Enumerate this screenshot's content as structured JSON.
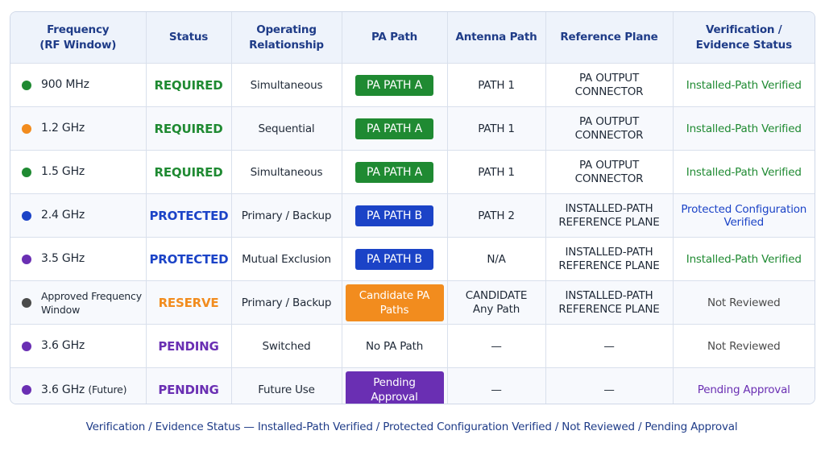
{
  "headers": {
    "frequency": "Frequency\n(RF Window)",
    "status": "Status",
    "operating": "Operating\nRelationship",
    "pa_path": "PA Path",
    "antenna_path": "Antenna Path",
    "reference_plane": "Reference Plane",
    "verification": "Verification /\nEvidence Status"
  },
  "colors": {
    "green": "#1f8a32",
    "orange": "#f28c1e",
    "blue": "#1b43c7",
    "purple": "#6a2fb3",
    "gray": "#4b4b4b",
    "header_text": "#1f3c88"
  },
  "rows": [
    {
      "frequency": "900 MHz",
      "dot": "green",
      "status": "REQUIRED",
      "status_color": "green",
      "operating": "Simultaneous",
      "pa_path": "PA PATH A",
      "pa_style": "pill",
      "pa_color": "green",
      "antenna": "PATH 1",
      "reference": "PA OUTPUT\nCONNECTOR",
      "verification": "Installed-Path Verified",
      "verification_color": "green"
    },
    {
      "frequency": "1.2 GHz",
      "dot": "orange",
      "status": "REQUIRED",
      "status_color": "green",
      "operating": "Sequential",
      "pa_path": "PA PATH A",
      "pa_style": "pill",
      "pa_color": "green",
      "antenna": "PATH 1",
      "reference": "PA OUTPUT\nCONNECTOR",
      "verification": "Installed-Path Verified",
      "verification_color": "green"
    },
    {
      "frequency": "1.5 GHz",
      "dot": "green",
      "status": "REQUIRED",
      "status_color": "green",
      "operating": "Simultaneous",
      "pa_path": "PA PATH A",
      "pa_style": "pill",
      "pa_color": "green",
      "antenna": "PATH 1",
      "reference": "PA OUTPUT\nCONNECTOR",
      "verification": "Installed-Path Verified",
      "verification_color": "green"
    },
    {
      "frequency": "2.4 GHz",
      "dot": "blue",
      "status": "PROTECTED",
      "status_color": "blue",
      "operating": "Primary / Backup",
      "pa_path": "PA PATH B",
      "pa_style": "pill",
      "pa_color": "blue",
      "antenna": "PATH 2",
      "reference": "INSTALLED-PATH\nREFERENCE PLANE",
      "verification": "Protected Configuration\nVerified",
      "verification_color": "blue"
    },
    {
      "frequency": "3.5 GHz",
      "dot": "purple",
      "status": "PROTECTED",
      "status_color": "blue",
      "operating": "Mutual Exclusion",
      "pa_path": "PA PATH B",
      "pa_style": "pill",
      "pa_color": "blue",
      "antenna": "N/A",
      "reference": "INSTALLED-PATH\nREFERENCE PLANE",
      "verification": "Installed-Path Verified",
      "verification_color": "green"
    },
    {
      "frequency": "Approved Frequency\nWindow",
      "dot": "gray",
      "freq_small": true,
      "status": "RESERVE",
      "status_color": "orange",
      "operating": "Primary / Backup",
      "pa_path": "Candidate PA Paths",
      "pa_style": "pill",
      "pa_color": "orange",
      "antenna": "CANDIDATE\nAny Path",
      "reference": "INSTALLED-PATH\nREFERENCE PLANE",
      "verification": "Not Reviewed",
      "verification_color": "gray"
    },
    {
      "frequency": "3.6 GHz",
      "dot": "purple",
      "status": "PENDING",
      "status_color": "purple",
      "operating": "Switched",
      "pa_path": "No PA Path",
      "pa_style": "text",
      "pa_color": "gray",
      "antenna": "—",
      "reference": "—",
      "verification": "Not Reviewed",
      "verification_color": "gray"
    },
    {
      "frequency": "3.6 GHz",
      "frequency_suffix": "(Future)",
      "dot": "purple",
      "status": "PENDING",
      "status_color": "purple",
      "operating": "Future Use",
      "pa_path": "Pending Approval",
      "pa_style": "pill",
      "pa_color": "purple",
      "antenna": "—",
      "reference": "—",
      "verification": "Pending Approval",
      "verification_color": "purple"
    }
  ],
  "footer": "Verification / Evidence Status — Installed-Path Verified / Protected Configuration Verified / Not Reviewed / Pending Approval"
}
